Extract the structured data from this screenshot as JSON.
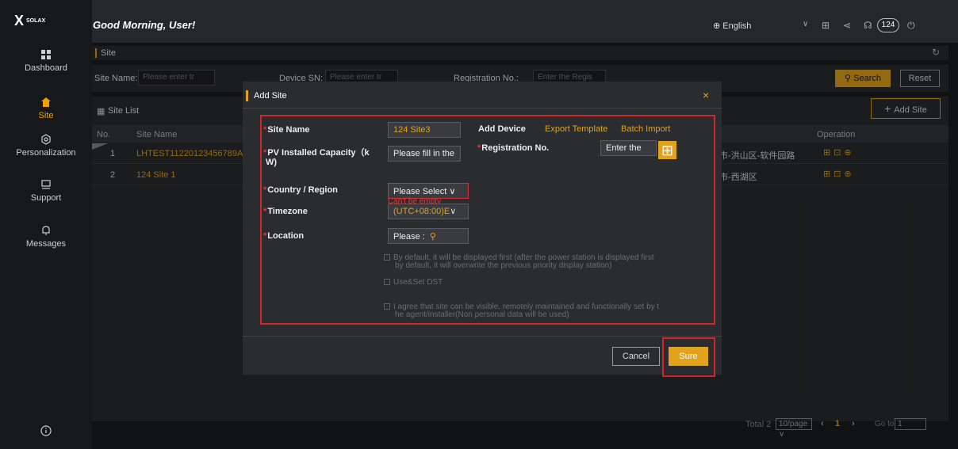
{
  "brand": {
    "logo": "X",
    "logo_small": "SOLAX"
  },
  "header": {
    "greeting": "Good Morning, User!",
    "language": "English",
    "badge": "124"
  },
  "sidebar": {
    "items": [
      {
        "label": "Dashboard",
        "icon": "dashboard-icon"
      },
      {
        "label": "Site",
        "icon": "site-home-icon"
      },
      {
        "label": "Personalization",
        "icon": "personalization-icon"
      },
      {
        "label": "Support",
        "icon": "support-icon"
      },
      {
        "label": "Messages",
        "icon": "bell-icon"
      }
    ]
  },
  "breadcrumb": "Site",
  "filters": {
    "site_name_label": "Site Name:",
    "site_name_placeholder": "Please enter tr",
    "device_sn_label": "Device SN:",
    "device_sn_placeholder": "Please enter tr",
    "registration_label": "Registration No.:",
    "registration_placeholder": "Enter the Regis",
    "search": "Search",
    "reset": "Reset"
  },
  "site_list": {
    "title": "Site List",
    "add_site": "Add Site",
    "columns": {
      "no": "No.",
      "site_name": "Site Name",
      "operation": "Operation"
    },
    "rows": [
      {
        "no": "1",
        "name": "LHTEST11220123456789A",
        "address": "汉市-洪山区-软件园路"
      },
      {
        "no": "2",
        "name": "124 Site 1",
        "address": "州市-西湖区"
      }
    ]
  },
  "pagination": {
    "total": "Total 2",
    "page_size": "10/page",
    "current": "1",
    "goto": "Go to",
    "goto_value": "1"
  },
  "modal": {
    "title": "Add Site",
    "close": "×",
    "site_name_label": "Site Name",
    "site_name_value": "124 Site3",
    "add_device_label": "Add Device",
    "export_template": "Export Template",
    "batch_import": "Batch Import",
    "pv_capacity_label_1": "PV Installed Capacity（k",
    "pv_capacity_label_2": "W)",
    "pv_capacity_placeholder": "Please fill in the",
    "registration_label": "Registration No.",
    "registration_placeholder": "Enter the",
    "country_label": "Country / Region",
    "country_placeholder": "Please Select",
    "country_error": "Can't be empty",
    "timezone_label": "Timezone",
    "timezone_value": "(UTC+08:00)E",
    "location_label": "Location",
    "location_placeholder": "Please :",
    "opt_default_1": "By default, it will be displayed first (after the power station is displayed first",
    "opt_default_2": "by default, it will overwrite the previous priority display station)",
    "opt_dst": "Use&Set DST",
    "opt_agree_1": "I agree that site can be visible, remotely maintained and functionally set by t",
    "opt_agree_2": "he agent/installer(Non personal data will be used)",
    "cancel": "Cancel",
    "sure": "Sure"
  },
  "colors": {
    "accent": "#e2a21b",
    "highlight": "#d32626"
  }
}
